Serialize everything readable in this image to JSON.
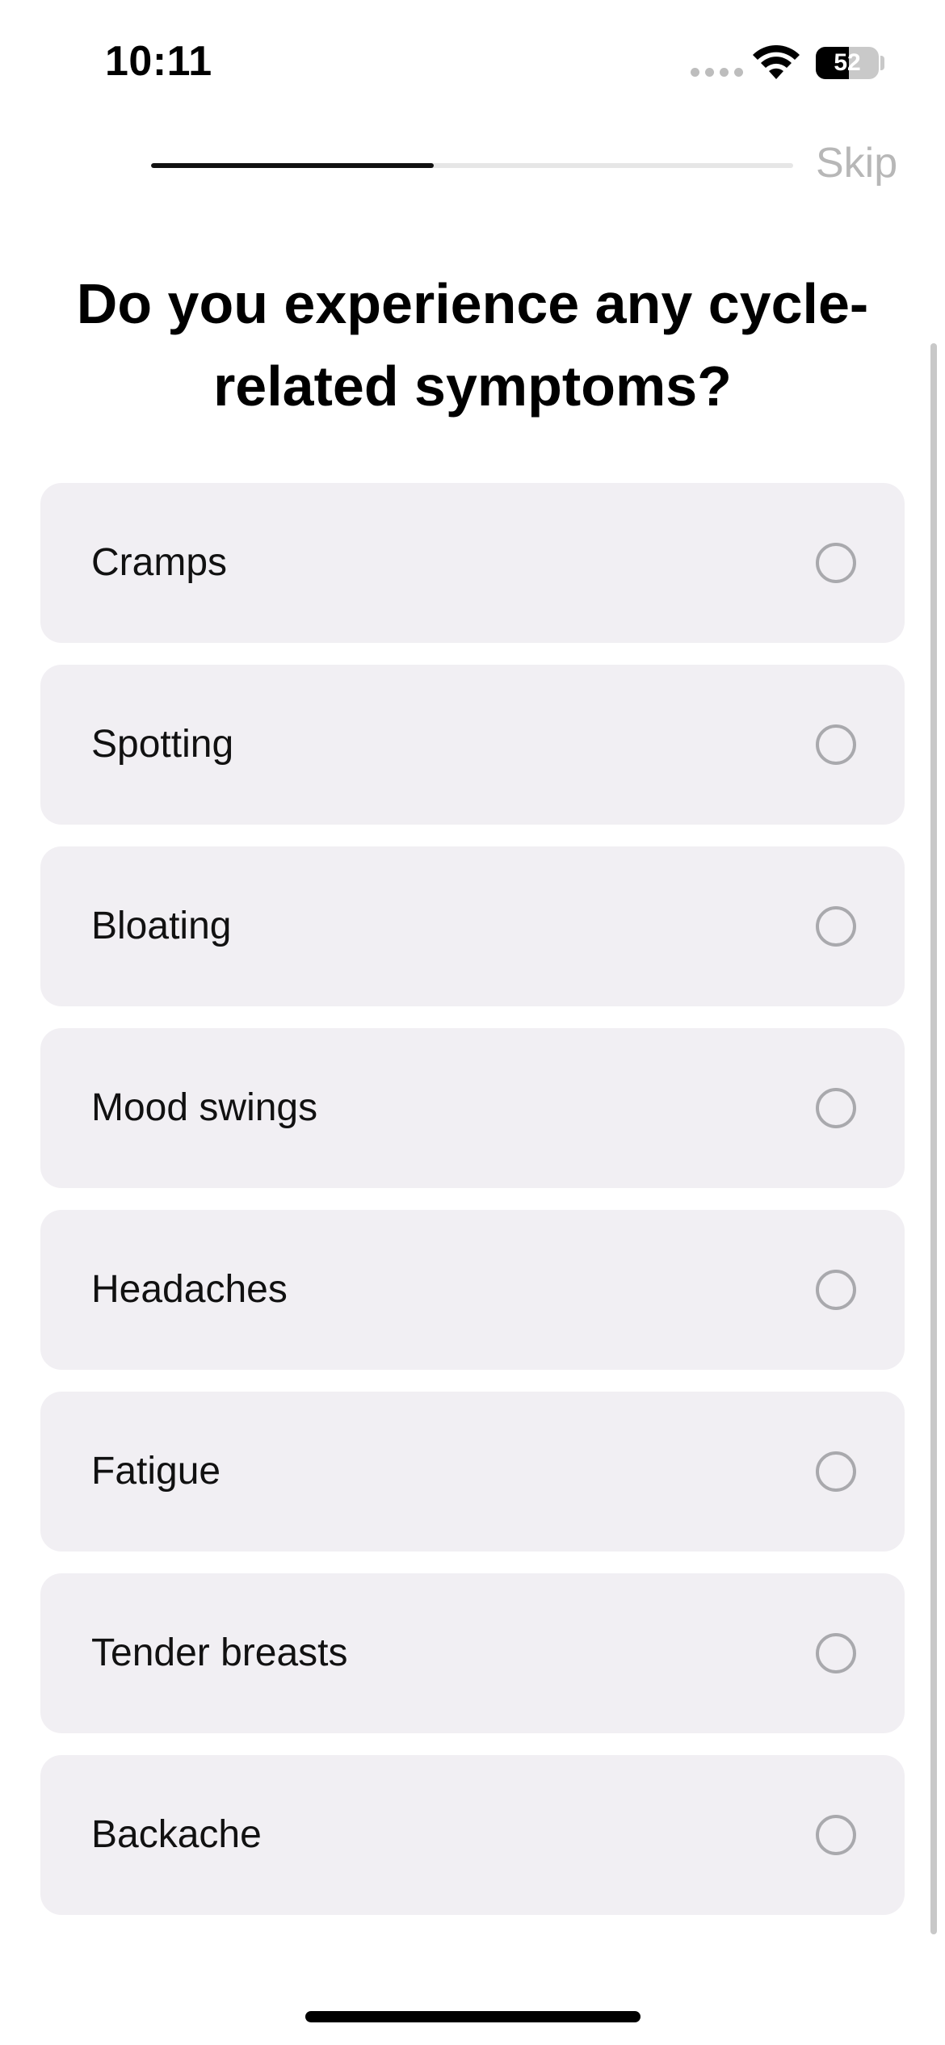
{
  "status_bar": {
    "time": "10:11",
    "battery_level": "52"
  },
  "onboarding": {
    "progress_fraction": 0.44,
    "skip_label": "Skip",
    "question": "Do you experience any cycle-related symptoms?",
    "options": [
      {
        "label": "Cramps",
        "selected": false
      },
      {
        "label": "Spotting",
        "selected": false
      },
      {
        "label": "Bloating",
        "selected": false
      },
      {
        "label": "Mood swings",
        "selected": false
      },
      {
        "label": "Headaches",
        "selected": false
      },
      {
        "label": "Fatigue",
        "selected": false
      },
      {
        "label": "Tender breasts",
        "selected": false
      },
      {
        "label": "Backache",
        "selected": false
      }
    ]
  },
  "colors": {
    "option_background": "#f1eff3",
    "radio_border": "#a9a9ad",
    "skip_text": "#b7b7b7",
    "progress_fill": "#111111",
    "progress_track": "#e6e6e6"
  },
  "icons": [
    "wifi-icon",
    "battery-icon",
    "signal-icon",
    "radio-unchecked-icon"
  ]
}
